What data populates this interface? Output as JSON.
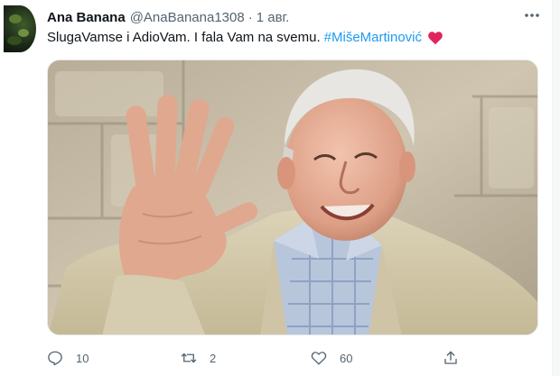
{
  "tweet": {
    "author": {
      "display_name": "Ana Banana",
      "handle": "@AnaBanana1308",
      "avatar_icon": "avatar-photo"
    },
    "separator": "·",
    "date": "1 авг.",
    "text": "SlugaVamse i AdioVam. I fala Vam na svemu.",
    "hashtag": "#MišeMartinović",
    "emoji": "red-heart",
    "media_description_icon": "photo",
    "more_icon": "ellipsis-icon",
    "actions": {
      "reply": {
        "icon": "reply-icon",
        "count": "10"
      },
      "retweet": {
        "icon": "retweet-icon",
        "count": "2"
      },
      "like": {
        "icon": "heart-outline-icon",
        "count": "60"
      },
      "share": {
        "icon": "share-icon"
      }
    },
    "colors": {
      "text": "#0f1419",
      "secondary": "#536471",
      "link": "#1d9bf0",
      "heart": "#e0245e"
    }
  }
}
